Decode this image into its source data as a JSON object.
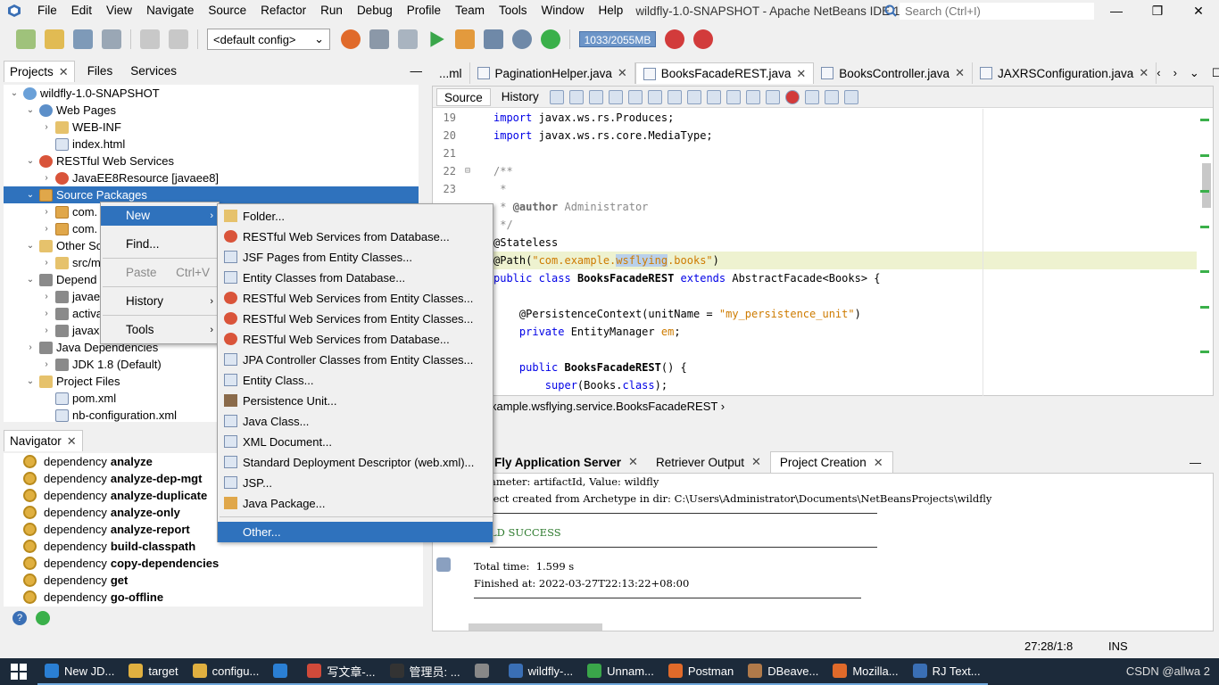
{
  "menubar": {
    "items": [
      "File",
      "Edit",
      "View",
      "Navigate",
      "Source",
      "Refactor",
      "Run",
      "Debug",
      "Profile",
      "Team",
      "Tools",
      "Window",
      "Help"
    ],
    "window_title": "wildfly-1.0-SNAPSHOT - Apache NetBeans IDE 13",
    "search_placeholder": "Search (Ctrl+I)"
  },
  "toolbar": {
    "config": "<default config>",
    "memory": "1033/2055MB"
  },
  "projects_panel": {
    "tabs": [
      "Projects",
      "Files",
      "Services"
    ],
    "tree": [
      {
        "label": "wildfly-1.0-SNAPSHOT",
        "indent": 0,
        "toggle": "open",
        "icon": "proj"
      },
      {
        "label": "Web Pages",
        "indent": 1,
        "toggle": "open",
        "icon": "globe"
      },
      {
        "label": "WEB-INF",
        "indent": 2,
        "toggle": "closed",
        "icon": "folder"
      },
      {
        "label": "index.html",
        "indent": 2,
        "toggle": "",
        "icon": "file"
      },
      {
        "label": "RESTful Web Services",
        "indent": 1,
        "toggle": "open",
        "icon": "rest"
      },
      {
        "label": "JavaEE8Resource [javaee8]",
        "indent": 2,
        "toggle": "closed",
        "icon": "rest"
      },
      {
        "label": "Source Packages",
        "indent": 1,
        "toggle": "open",
        "icon": "pkg",
        "selected": true
      },
      {
        "label": "com.",
        "indent": 2,
        "toggle": "closed",
        "icon": "pkg"
      },
      {
        "label": "com.",
        "indent": 2,
        "toggle": "closed",
        "icon": "pkg"
      },
      {
        "label": "Other So",
        "indent": 1,
        "toggle": "open",
        "icon": "folder"
      },
      {
        "label": "src/m",
        "indent": 2,
        "toggle": "closed",
        "icon": "folder"
      },
      {
        "label": "Depend",
        "indent": 1,
        "toggle": "open",
        "icon": "jar"
      },
      {
        "label": "javae",
        "indent": 2,
        "toggle": "closed",
        "icon": "jar"
      },
      {
        "label": "activa",
        "indent": 2,
        "toggle": "closed",
        "icon": "jar"
      },
      {
        "label": "javax",
        "indent": 2,
        "toggle": "closed",
        "icon": "jar"
      },
      {
        "label": "Java Dependencies",
        "indent": 1,
        "toggle": "closed",
        "icon": "jar"
      },
      {
        "label": "JDK 1.8 (Default)",
        "indent": 2,
        "toggle": "closed",
        "icon": "jar"
      },
      {
        "label": "Project Files",
        "indent": 1,
        "toggle": "open",
        "icon": "folder"
      },
      {
        "label": "pom.xml",
        "indent": 2,
        "toggle": "",
        "icon": "file"
      },
      {
        "label": "nb-configuration.xml",
        "indent": 2,
        "toggle": "",
        "icon": "file"
      }
    ]
  },
  "navigator": {
    "title": "Navigator",
    "items": [
      {
        "prefix": "dependency",
        "name": "analyze"
      },
      {
        "prefix": "dependency",
        "name": "analyze-dep-mgt"
      },
      {
        "prefix": "dependency",
        "name": "analyze-duplicate"
      },
      {
        "prefix": "dependency",
        "name": "analyze-only"
      },
      {
        "prefix": "dependency",
        "name": "analyze-report"
      },
      {
        "prefix": "dependency",
        "name": "build-classpath"
      },
      {
        "prefix": "dependency",
        "name": "copy-dependencies"
      },
      {
        "prefix": "dependency",
        "name": "get"
      },
      {
        "prefix": "dependency",
        "name": "go-offline"
      }
    ]
  },
  "editor": {
    "tabs": [
      "...ml",
      "PaginationHelper.java",
      "BooksFacadeREST.java",
      "BooksController.java",
      "JAXRSConfiguration.java"
    ],
    "active_tab": 2,
    "source_label": "Source",
    "history_label": "History",
    "breadcrumb": "xample.wsflying.service.BooksFacadeREST"
  },
  "context_menu": {
    "items": [
      {
        "label": "New",
        "shortcut": "",
        "arrow": true,
        "highlighted": true,
        "disabled": false
      },
      {
        "label": "Find...",
        "shortcut": "",
        "arrow": false,
        "highlighted": false,
        "disabled": false
      },
      {
        "label": "Paste",
        "shortcut": "Ctrl+V",
        "arrow": false,
        "highlighted": false,
        "disabled": true
      },
      {
        "label": "History",
        "shortcut": "",
        "arrow": true,
        "highlighted": false,
        "disabled": false
      },
      {
        "label": "Tools",
        "shortcut": "",
        "arrow": true,
        "highlighted": false,
        "disabled": false
      }
    ]
  },
  "new_submenu": {
    "items": [
      {
        "label": "Folder...",
        "icon": "folder"
      },
      {
        "label": "RESTful Web Services from Database...",
        "icon": "rest"
      },
      {
        "label": "JSF Pages from Entity Classes...",
        "icon": "file"
      },
      {
        "label": "Entity Classes from Database...",
        "icon": "file"
      },
      {
        "label": "RESTful Web Services from Entity Classes...",
        "icon": "rest"
      },
      {
        "label": "RESTful Web Services from Entity Classes...",
        "icon": "rest"
      },
      {
        "label": "RESTful Web Services from Database...",
        "icon": "rest"
      },
      {
        "label": "JPA Controller Classes from Entity Classes...",
        "icon": "file"
      },
      {
        "label": "Entity Class...",
        "icon": "file"
      },
      {
        "label": "Persistence Unit...",
        "icon": "jar"
      },
      {
        "label": "Java Class...",
        "icon": "file"
      },
      {
        "label": "XML Document...",
        "icon": "file"
      },
      {
        "label": "Standard Deployment Descriptor (web.xml)...",
        "icon": "file"
      },
      {
        "label": "JSP...",
        "icon": "file"
      },
      {
        "label": "Java Package...",
        "icon": "pkg"
      },
      {
        "label": "Other...",
        "icon": "",
        "highlighted": true
      }
    ]
  },
  "output": {
    "tabs": [
      "Fly Application Server",
      "Retriever Output",
      "Project Creation"
    ],
    "active_tab": 2,
    "lines": {
      "param": "ameter: artifactId, Value: wildfly",
      "created": "ject created from Archetype in dir: C:\\Users\\Administrator\\Documents\\NetBeansProjects\\wildfly",
      "success": "LD SUCCESS",
      "total": "Total time:  1.599 s",
      "finished": "Finished at: 2022-03-27T22:13:22+08:00"
    }
  },
  "status": {
    "position": "27:28/1:8",
    "mode": "INS"
  },
  "taskbar": {
    "apps": [
      "New JD...",
      "target",
      "configu...",
      "",
      "写文章-...",
      "管理员: ...",
      "",
      "wildfly-...",
      "Unnam...",
      "Postman",
      "DBeave...",
      "Mozilla...",
      "RJ Text..."
    ],
    "tray": "CSDN @allwa 2"
  }
}
